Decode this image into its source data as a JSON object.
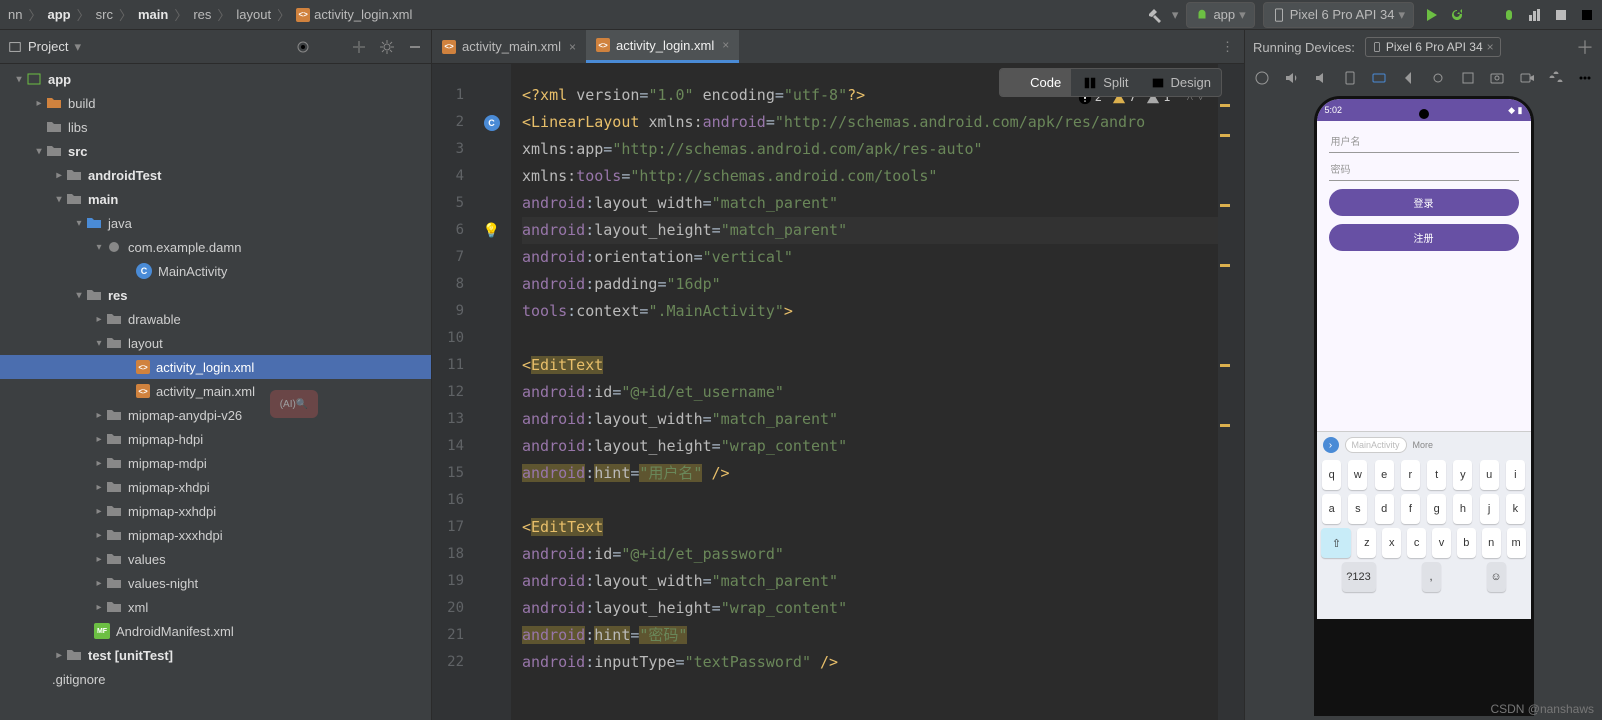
{
  "breadcrumbs": [
    "nn",
    "app",
    "src",
    "main",
    "res",
    "layout"
  ],
  "breadcrumb_file": "activity_login.xml",
  "top_right": {
    "run_config": "app",
    "device": "Pixel 6 Pro API 34"
  },
  "project": {
    "title": "Project",
    "tree": {
      "app": "app",
      "build": "build",
      "libs": "libs",
      "src": "src",
      "androidTest": "androidTest",
      "main": "main",
      "java": "java",
      "package": "com.example.damn",
      "main_activity": "MainActivity",
      "res": "res",
      "drawable": "drawable",
      "layout": "layout",
      "login_xml": "activity_login.xml",
      "main_xml": "activity_main.xml",
      "mipmap_anydpi": "mipmap-anydpi-v26",
      "mipmap_hdpi": "mipmap-hdpi",
      "mipmap_mdpi": "mipmap-mdpi",
      "mipmap_xhdpi": "mipmap-xhdpi",
      "mipmap_xxhdpi": "mipmap-xxhdpi",
      "mipmap_xxxhdpi": "mipmap-xxxhdpi",
      "values": "values",
      "values_night": "values-night",
      "xml": "xml",
      "manifest": "AndroidManifest.xml",
      "test": "test [unitTest]",
      "gitignore": ".gitignore"
    }
  },
  "editor": {
    "tabs": {
      "main": "activity_main.xml",
      "login": "activity_login.xml"
    },
    "view_switcher": {
      "code": "Code",
      "split": "Split",
      "design": "Design"
    },
    "inspections": {
      "errors": "2",
      "warnings": "7",
      "weak": "1"
    },
    "line_nums": [
      "1",
      "2",
      "3",
      "4",
      "5",
      "6",
      "7",
      "8",
      "9",
      "10",
      "11",
      "12",
      "13",
      "14",
      "15",
      "16",
      "17",
      "18",
      "19",
      "20",
      "21",
      "22"
    ],
    "code": {
      "l1_a": "<?xml",
      " l1_b": "version",
      "l1_c": "\"1.0\"",
      "l1_d": "encoding",
      "l1_e": "\"utf-8\"",
      "l1_f": "?>",
      "l2_a": "<",
      "l2_b": "LinearLayout",
      "l2_c": "xmlns:",
      "l2_d": "android",
      "l2_e": "=",
      "l2_f": "\"http://schemas.android.com/apk/res/andro",
      "l3_a": "xmlns:",
      "l3_b": "app",
      "l3_c": "=",
      "l3_d": "\"http://schemas.android.com/apk/res-auto\"",
      "l4_a": "xmlns:",
      "l4_b": "tools",
      "l4_c": "=",
      "l4_d": "\"http://schemas.android.com/tools\"",
      "l5_a": "android",
      "l5_b": ":",
      "l5_c": "layout_width",
      "l5_d": "=",
      "l5_e": "\"match_parent\"",
      "l6_a": "android",
      "l6_b": ":",
      "l6_c": "layout_height",
      "l6_d": "=",
      "l6_e": "\"match_parent\"",
      "l7_a": "android",
      "l7_b": ":",
      "l7_c": "orientation",
      "l7_d": "=",
      "l7_e": "\"vertical\"",
      "l8_a": "android",
      "l8_b": ":",
      "l8_c": "padding",
      "l8_d": "=",
      "l8_e": "\"16dp\"",
      "l9_a": "tools",
      "l9_b": ":",
      "l9_c": "context",
      "l9_d": "=",
      "l9_e": "\".MainActivity\"",
      "l9_f": ">",
      "l11_a": "<",
      "l11_b": "EditText",
      "l12_a": "android",
      "l12_b": ":",
      "l12_c": "id",
      "l12_d": "=",
      "l12_e": "\"@+id/et_username\"",
      "l13_a": "android",
      "l13_b": ":",
      "l13_c": "layout_width",
      "l13_d": "=",
      "l13_e": "\"match_parent\"",
      "l14_a": "android",
      "l14_b": ":",
      "l14_c": "layout_height",
      "l14_d": "=",
      "l14_e": "\"wrap_content\"",
      "l15_a": "android",
      "l15_b": ":",
      "l15_c": "hint",
      "l15_d": "=",
      "l15_e": "\"用户名\"",
      "l15_f": "/>",
      "l17_a": "<",
      "l17_b": "EditText",
      "l18_a": "android",
      "l18_b": ":",
      "l18_c": "id",
      "l18_d": "=",
      "l18_e": "\"@+id/et_password\"",
      "l19_a": "android",
      "l19_b": ":",
      "l19_c": "layout_width",
      "l19_d": "=",
      "l19_e": "\"match_parent\"",
      "l20_a": "android",
      "l20_b": ":",
      "l20_c": "layout_height",
      "l20_d": "=",
      "l20_e": "\"wrap_content\"",
      "l21_a": "android",
      "l21_b": ":",
      "l21_c": "hint",
      "l21_d": "=",
      "l21_e": "\"密码\"",
      "l22_a": "android",
      "l22_b": ":",
      "l22_c": "inputType",
      "l22_d": "=",
      "l22_e": "\"textPassword\"",
      "l22_f": "/>"
    }
  },
  "running": {
    "title": "Running Devices:",
    "device": "Pixel 6 Pro API 34"
  },
  "phone": {
    "time": "5:02",
    "username_hint": "用户名",
    "password_hint": "密码",
    "login_btn": "登录",
    "register_btn": "注册",
    "suggest": "MainActivity",
    "suggest_more": "More",
    "kb_row1": [
      "q",
      "w",
      "e",
      "r",
      "t",
      "y",
      "u",
      "i"
    ],
    "kb_row2": [
      "a",
      "s",
      "d",
      "f",
      "g",
      "h",
      "j",
      "k"
    ],
    "kb_row3": [
      "z",
      "x",
      "c",
      "v",
      "b",
      "n",
      "m"
    ],
    "num_toggle": "?123"
  },
  "watermark": "CSDN @nanshaws"
}
